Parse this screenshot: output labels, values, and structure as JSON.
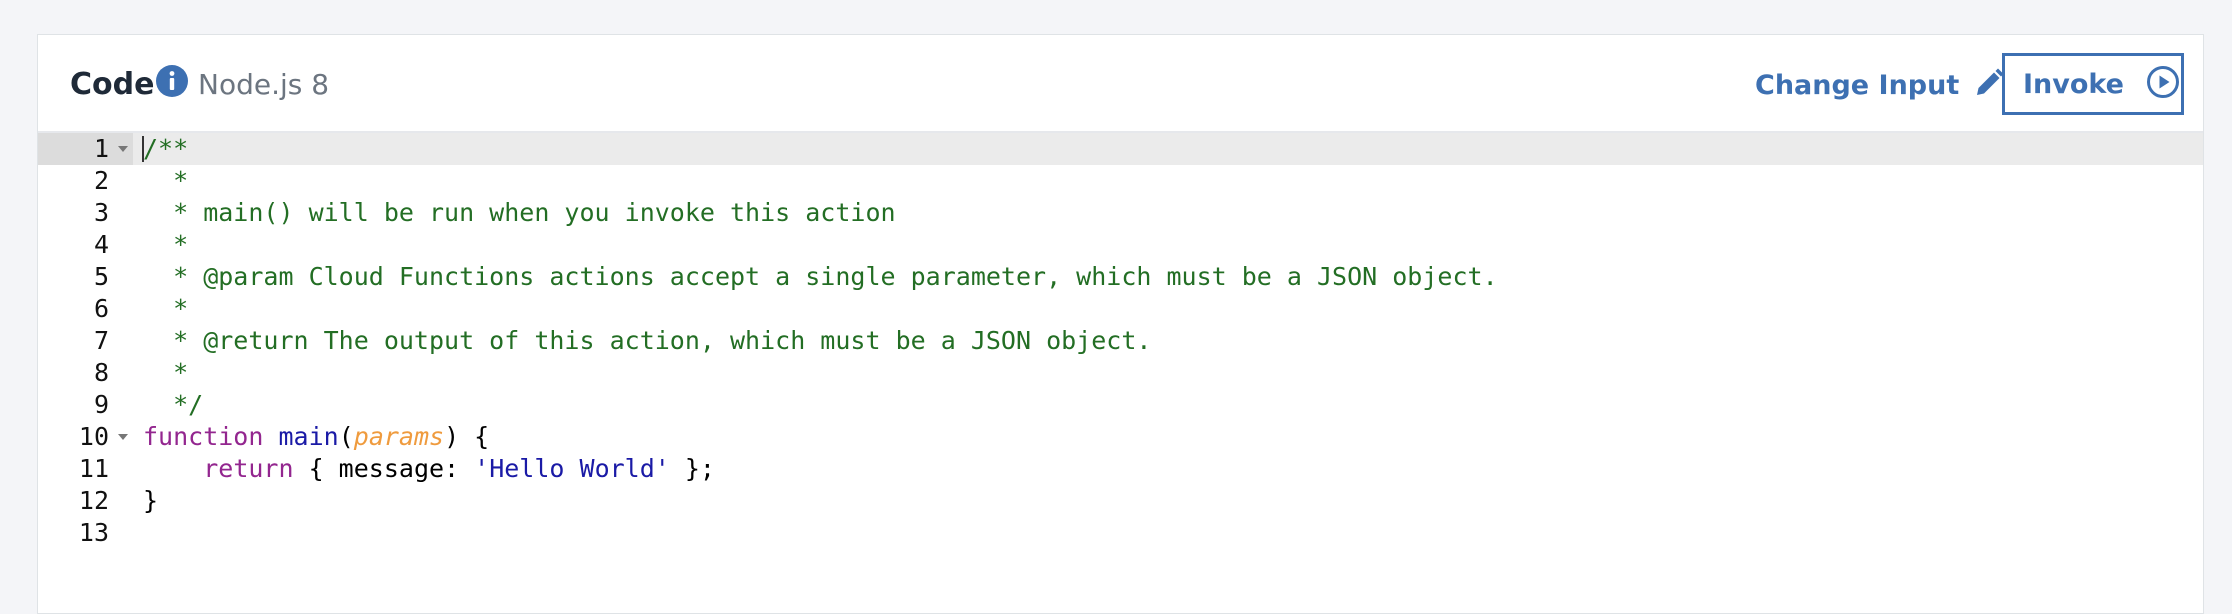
{
  "header": {
    "title": "Code",
    "runtime": "Node.js 8",
    "change_input_label": "Change Input",
    "invoke_label": "Invoke"
  },
  "editor": {
    "lines": [
      {
        "num": "1",
        "fold": true
      },
      {
        "num": "2"
      },
      {
        "num": "3"
      },
      {
        "num": "4"
      },
      {
        "num": "5"
      },
      {
        "num": "6"
      },
      {
        "num": "7"
      },
      {
        "num": "8"
      },
      {
        "num": "9"
      },
      {
        "num": "10",
        "fold": true
      },
      {
        "num": "11"
      },
      {
        "num": "12"
      },
      {
        "num": "13"
      }
    ],
    "code": {
      "l1": "/**",
      "l2": "  *",
      "l3": "  * main() will be run when you invoke this action",
      "l4": "  *",
      "l5": "  * @param Cloud Functions actions accept a single parameter, which must be a JSON object.",
      "l6": "  *",
      "l7": "  * @return The output of this action, which must be a JSON object.",
      "l8": "  *",
      "l9": "  */",
      "l10_kw": "function",
      "l10_fn": "main",
      "l10_open": "(",
      "l10_param": "params",
      "l10_close": ") {",
      "l11_indent": "    ",
      "l11_kw": "return",
      "l11_mid": " { message: ",
      "l11_str": "'Hello World'",
      "l11_end": " };",
      "l12": "}",
      "l13": ""
    }
  },
  "colors": {
    "accent": "#3d70b2",
    "comment": "#236e24",
    "keyword": "#93268f",
    "function": "#1a1aa6",
    "param": "#ef9b3e"
  },
  "icons": {
    "info": "info-icon",
    "pencil": "pencil-icon",
    "play": "play-circle-icon",
    "fold": "fold-arrow-icon"
  }
}
